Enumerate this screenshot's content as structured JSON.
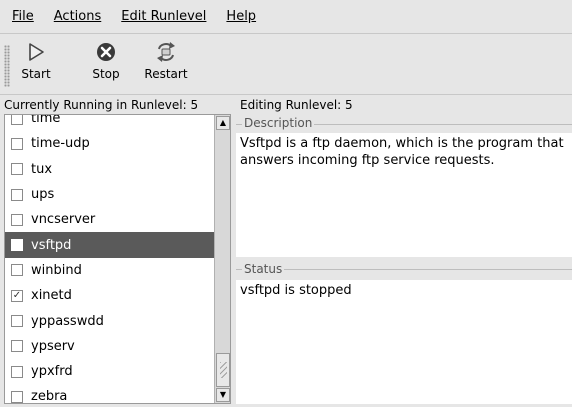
{
  "menu": {
    "file": "File",
    "actions": "Actions",
    "edit_runlevel": "Edit Runlevel",
    "help": "Help"
  },
  "toolbar": {
    "start_label": "Start",
    "stop_label": "Stop",
    "restart_label": "Restart",
    "start_icon": "play-icon",
    "stop_icon": "stop-icon",
    "restart_icon": "restart-icon"
  },
  "statusline": {
    "current": "Currently Running in Runlevel: 5",
    "editing": "Editing Runlevel: 5"
  },
  "services": [
    {
      "name": "time",
      "checked": false,
      "selected": false
    },
    {
      "name": "time-udp",
      "checked": false,
      "selected": false
    },
    {
      "name": "tux",
      "checked": false,
      "selected": false
    },
    {
      "name": "ups",
      "checked": false,
      "selected": false
    },
    {
      "name": "vncserver",
      "checked": false,
      "selected": false
    },
    {
      "name": "vsftpd",
      "checked": false,
      "selected": true
    },
    {
      "name": "winbind",
      "checked": false,
      "selected": false
    },
    {
      "name": "xinetd",
      "checked": true,
      "selected": false
    },
    {
      "name": "yppasswdd",
      "checked": false,
      "selected": false
    },
    {
      "name": "ypserv",
      "checked": false,
      "selected": false
    },
    {
      "name": "ypxfrd",
      "checked": false,
      "selected": false
    },
    {
      "name": "zebra",
      "checked": false,
      "selected": false
    }
  ],
  "description": {
    "label": "Description",
    "text": "Vsftpd is a ftp daemon, which is the program that answers incoming ftp service requests."
  },
  "status": {
    "label": "Status",
    "text": "vsftpd is stopped"
  },
  "colors": {
    "selection": "#5a5a5a",
    "background": "#e6e6e6"
  }
}
